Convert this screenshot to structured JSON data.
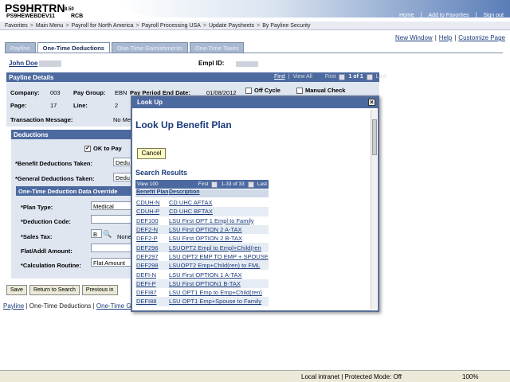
{
  "header": {
    "system_name": "PS9HRTRN",
    "version": "8.50",
    "database": "PS9HEWEBDEV11",
    "user": "RCB",
    "links": [
      "Home",
      "Add to Favorites",
      "Sign out"
    ]
  },
  "menubar": {
    "items": [
      "Favorites",
      "Main Menu",
      "Payroll for North America",
      "Payroll Processing USA",
      "Update Paysheets",
      "By Payline Security"
    ],
    "sep": ">"
  },
  "page_links": [
    "New Window",
    "Help",
    "Customize Page"
  ],
  "tabs": [
    "Payline",
    "One-Time Deductions",
    "One-Time Garnishments",
    "One-Time Taxes"
  ],
  "employee": {
    "name": "John Doe",
    "empl_id_label": "Empl ID:"
  },
  "payline": {
    "title": "Payline Details",
    "find": "Find",
    "view_all": "View All",
    "first": "First",
    "counter": "1 of 1",
    "last": "Last",
    "company_label": "Company:",
    "company": "003",
    "pay_group_label": "Pay Group:",
    "pay_group": "EBN",
    "pay_period_label": "Pay Period End Date:",
    "pay_period": "01/08/2012",
    "off_cycle": "Off Cycle",
    "manual_check": "Manual Check",
    "page_label": "Page:",
    "page": "17",
    "line_label": "Line:",
    "line": "2",
    "txn_msg_label": "Transaction Message:",
    "txn_msg": "No Me"
  },
  "deductions": {
    "title": "Deductions",
    "ok_to_pay": "OK to Pay",
    "benefit_label": "*Benefit Deductions Taken:",
    "benefit_val": "Dedu",
    "general_label": "*General Deductions Taken:",
    "general_val": "Dedu",
    "override_title": "One-Time Deduction Data Override",
    "plan_type_label": "*Plan Type:",
    "plan_type": "Medical",
    "ded_code_label": "*Deduction Code:",
    "sales_tax_label": "*Sales Tax:",
    "sales_tax": "B",
    "sales_tax_desc": "None",
    "flat_label": "Flat/Addl Amount:",
    "calc_label": "*Calculation Routine:",
    "calc": "Flat Amount"
  },
  "bottom_buttons": [
    "Save",
    "Return to Search",
    "Previous in"
  ],
  "bottom_links": [
    "Payline",
    "One-Time Deductions",
    "One-Time Gar"
  ],
  "statusbar": {
    "zone": "Local intranet | Protected Mode: Off",
    "zoom": "100%"
  },
  "modal": {
    "title": "Look Up",
    "heading": "Look Up Benefit Plan",
    "cancel": "Cancel",
    "results_title": "Search Results",
    "nav": {
      "view": "View 100",
      "first": "First",
      "range": "1-33 of 33",
      "last": "Last"
    },
    "col_plan": "Benefit Plan",
    "col_desc": "Description",
    "rows": [
      {
        "plan": "CDUH-N",
        "desc": "CD UHC AFTAX"
      },
      {
        "plan": "CDUH-P",
        "desc": "CD UHC BFTAX"
      },
      {
        "plan": "DEF100",
        "desc": "LSU First OPT 1 Empl to Family"
      },
      {
        "plan": "DEF2-N",
        "desc": "LSU First OPTION 2 A-TAX"
      },
      {
        "plan": "DEF2-P",
        "desc": "LSU First OPTION 2 B-TAX"
      },
      {
        "plan": "DEF296",
        "desc": "LSUOPT2 Empl to Empl+Child(ren"
      },
      {
        "plan": "DEF297",
        "desc": "LSU OPT2 EMP TO EMP + SPOUSE"
      },
      {
        "plan": "DEF298",
        "desc": "LSUOPT2 Emp+Child(ren) to FML"
      },
      {
        "plan": "DEFI-N",
        "desc": "LSU First OPTION 1 A-TAX"
      },
      {
        "plan": "DEFI-P",
        "desc": "LSU First OPTION1 B-TAX"
      },
      {
        "plan": "DEFI87",
        "desc": "LSU OPT1 Emp to Emp+Child(ren)"
      },
      {
        "plan": "DEFI88",
        "desc": "LSU OPT1 Emp+Spouse to Family"
      }
    ]
  }
}
